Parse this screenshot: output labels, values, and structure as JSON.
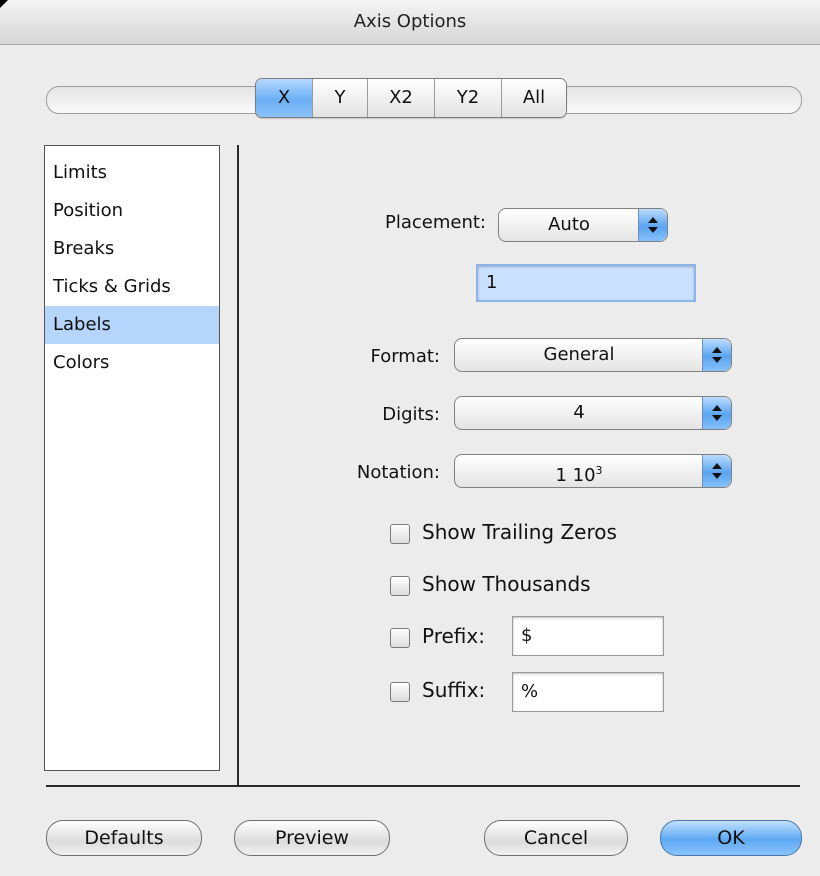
{
  "window": {
    "title": "Axis Options"
  },
  "tabs": [
    {
      "label": "X",
      "selected": true
    },
    {
      "label": "Y",
      "selected": false
    },
    {
      "label": "X2",
      "selected": false
    },
    {
      "label": "Y2",
      "selected": false
    },
    {
      "label": "All",
      "selected": false
    }
  ],
  "sidebar": {
    "items": [
      {
        "label": "Limits",
        "selected": false
      },
      {
        "label": "Position",
        "selected": false
      },
      {
        "label": "Breaks",
        "selected": false
      },
      {
        "label": "Ticks & Grids",
        "selected": false
      },
      {
        "label": "Labels",
        "selected": true
      },
      {
        "label": "Colors",
        "selected": false
      }
    ]
  },
  "placement": {
    "label": "Placement:",
    "value": "Auto",
    "field_value": "1"
  },
  "format": {
    "label": "Format:",
    "value": "General"
  },
  "digits": {
    "label": "Digits:",
    "value": "4"
  },
  "notation": {
    "label": "Notation:",
    "value_base": "1 10",
    "value_exp": "3"
  },
  "checks": {
    "trailing_zeros": {
      "label": "Show Trailing Zeros",
      "checked": false
    },
    "thousands": {
      "label": "Show Thousands",
      "checked": false
    },
    "prefix": {
      "label": "Prefix:",
      "checked": false,
      "value": "$"
    },
    "suffix": {
      "label": "Suffix:",
      "checked": false,
      "value": "%"
    }
  },
  "buttons": {
    "defaults": "Defaults",
    "preview": "Preview",
    "cancel": "Cancel",
    "ok": "OK"
  },
  "colors": {
    "selection": "#b5d5fb",
    "accent_blue": "#6aaef5"
  }
}
